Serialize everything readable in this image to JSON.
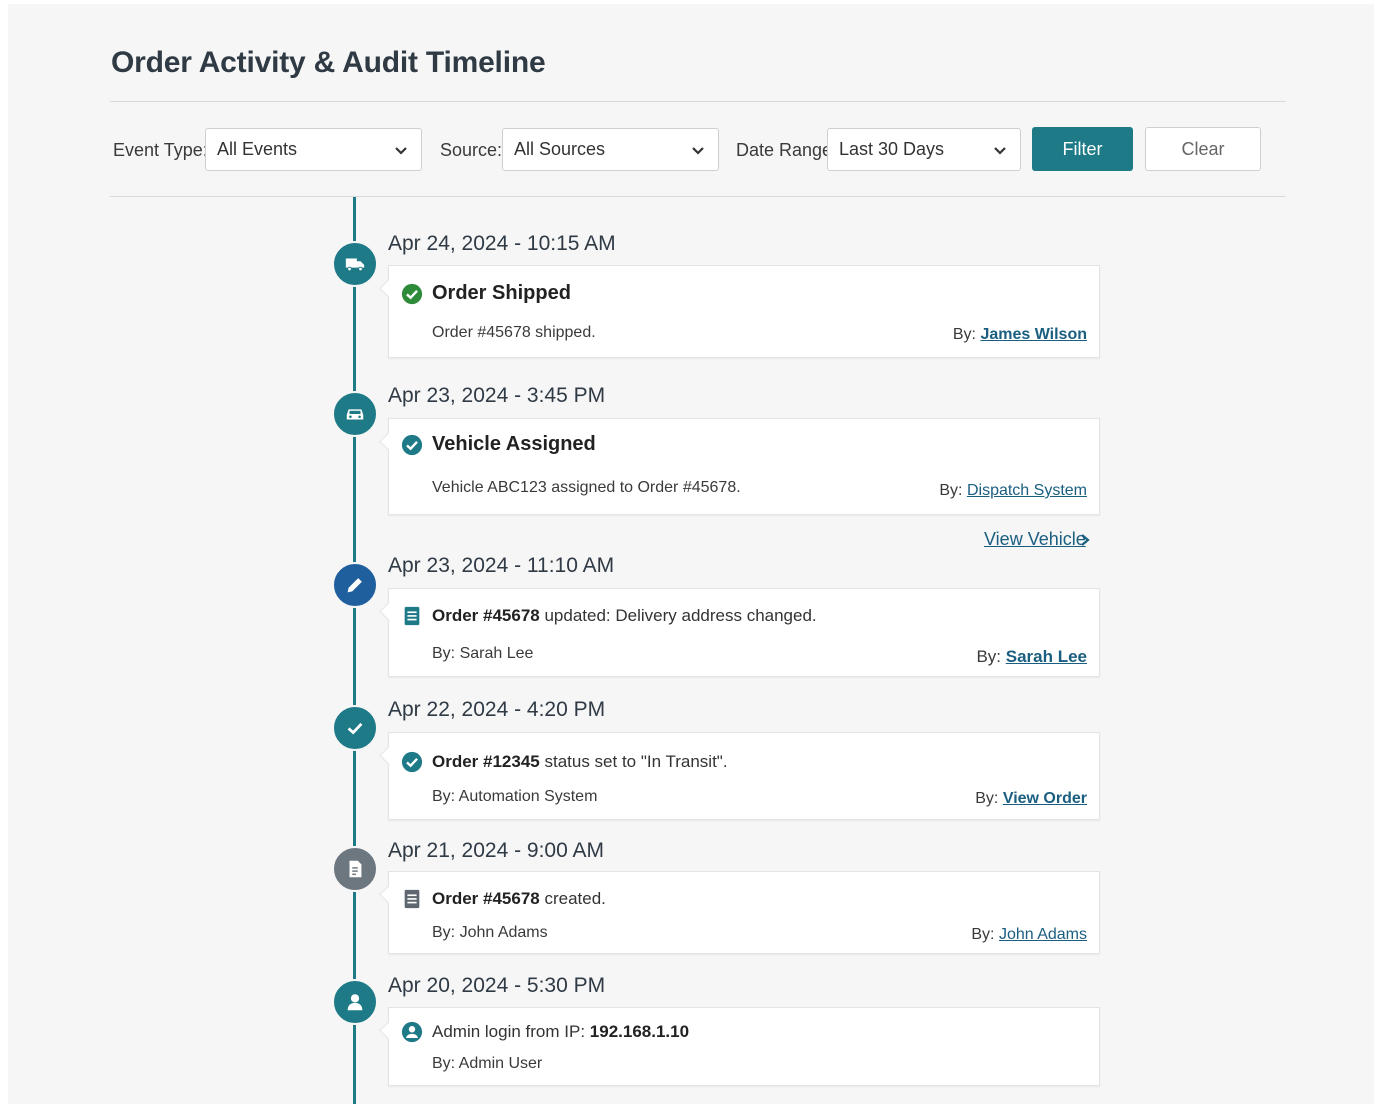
{
  "page": {
    "title": "Order Activity & Audit Timeline"
  },
  "filters": {
    "event_type_label": "Event Type:",
    "event_type_value": "All Events",
    "source_label": "Source:",
    "source_value": "All Sources",
    "date_range_label": "Date Range:",
    "date_range_value": "Last 30 Days",
    "filter_button": "Filter",
    "clear_button": "Clear"
  },
  "colors": {
    "accent": "#1d7a86",
    "link": "#1a5e80",
    "node_gray": "#6d7780",
    "node_blue": "#1f5f9e",
    "check_green": "#2e8b3a"
  },
  "events": [
    {
      "node_icon": "truck-icon",
      "date": "Apr 24, 2024 - 10:15 AM",
      "title": "Order Shipped",
      "title_icon": "check-circle-icon",
      "description": "Order #45678 shipped.",
      "by_label": "By:",
      "by_value": "James Wilson"
    },
    {
      "node_icon": "car-icon",
      "date": "Apr 23, 2024 - 3:45 PM",
      "title": "Vehicle Assigned",
      "title_icon": "check-circle-icon",
      "description": "Vehicle ABC123 assigned to Order #45678.",
      "by_label": "By:",
      "by_value": "Dispatch System",
      "extra_link": "View Vehicle"
    },
    {
      "node_icon": "pencil-icon",
      "date": "Apr 23, 2024 - 11:10 AM",
      "line_bold": "Order #45678",
      "line_rest": " updated: Delivery address changed.",
      "line_icon": "document-icon",
      "description": "By: Sarah Lee",
      "by_label": "By:",
      "by_value": "Sarah Lee"
    },
    {
      "node_icon": "check-icon",
      "date": "Apr 22, 2024 - 4:20 PM",
      "line_bold": "Order #12345",
      "line_rest": " status set to \"In Transit\".",
      "line_icon": "check-circle-icon",
      "description": "By: Automation System",
      "by_label": "By:",
      "by_value": "View Order"
    },
    {
      "node_icon": "document-icon",
      "date": "Apr 21, 2024 - 9:00 AM",
      "line_bold": "Order #45678",
      "line_rest": " created.",
      "line_icon": "document-icon",
      "description": "By: John Adams",
      "by_label": "By:",
      "by_value": "John Adams"
    },
    {
      "node_icon": "user-icon",
      "date": "Apr 20, 2024 - 5:30 PM",
      "line_plain": "Admin login from IP: ",
      "line_bold_end": "192.168.1.10",
      "line_icon": "user-circle-icon",
      "description": "By: Admin User"
    }
  ]
}
